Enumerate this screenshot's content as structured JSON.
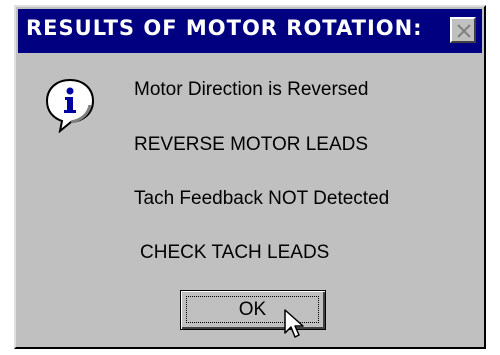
{
  "dialog": {
    "title": "RESULTS OF MOTOR ROTATION:",
    "close_icon": "close-icon",
    "icon": "information-icon",
    "messages": [
      "Motor Direction is Reversed",
      "REVERSE MOTOR LEADS",
      "Tach Feedback NOT Detected",
      "CHECK TACH LEADS"
    ],
    "ok_label": "OK"
  },
  "colors": {
    "titlebar": "#000080",
    "dialog_face": "#c0c0c0"
  }
}
